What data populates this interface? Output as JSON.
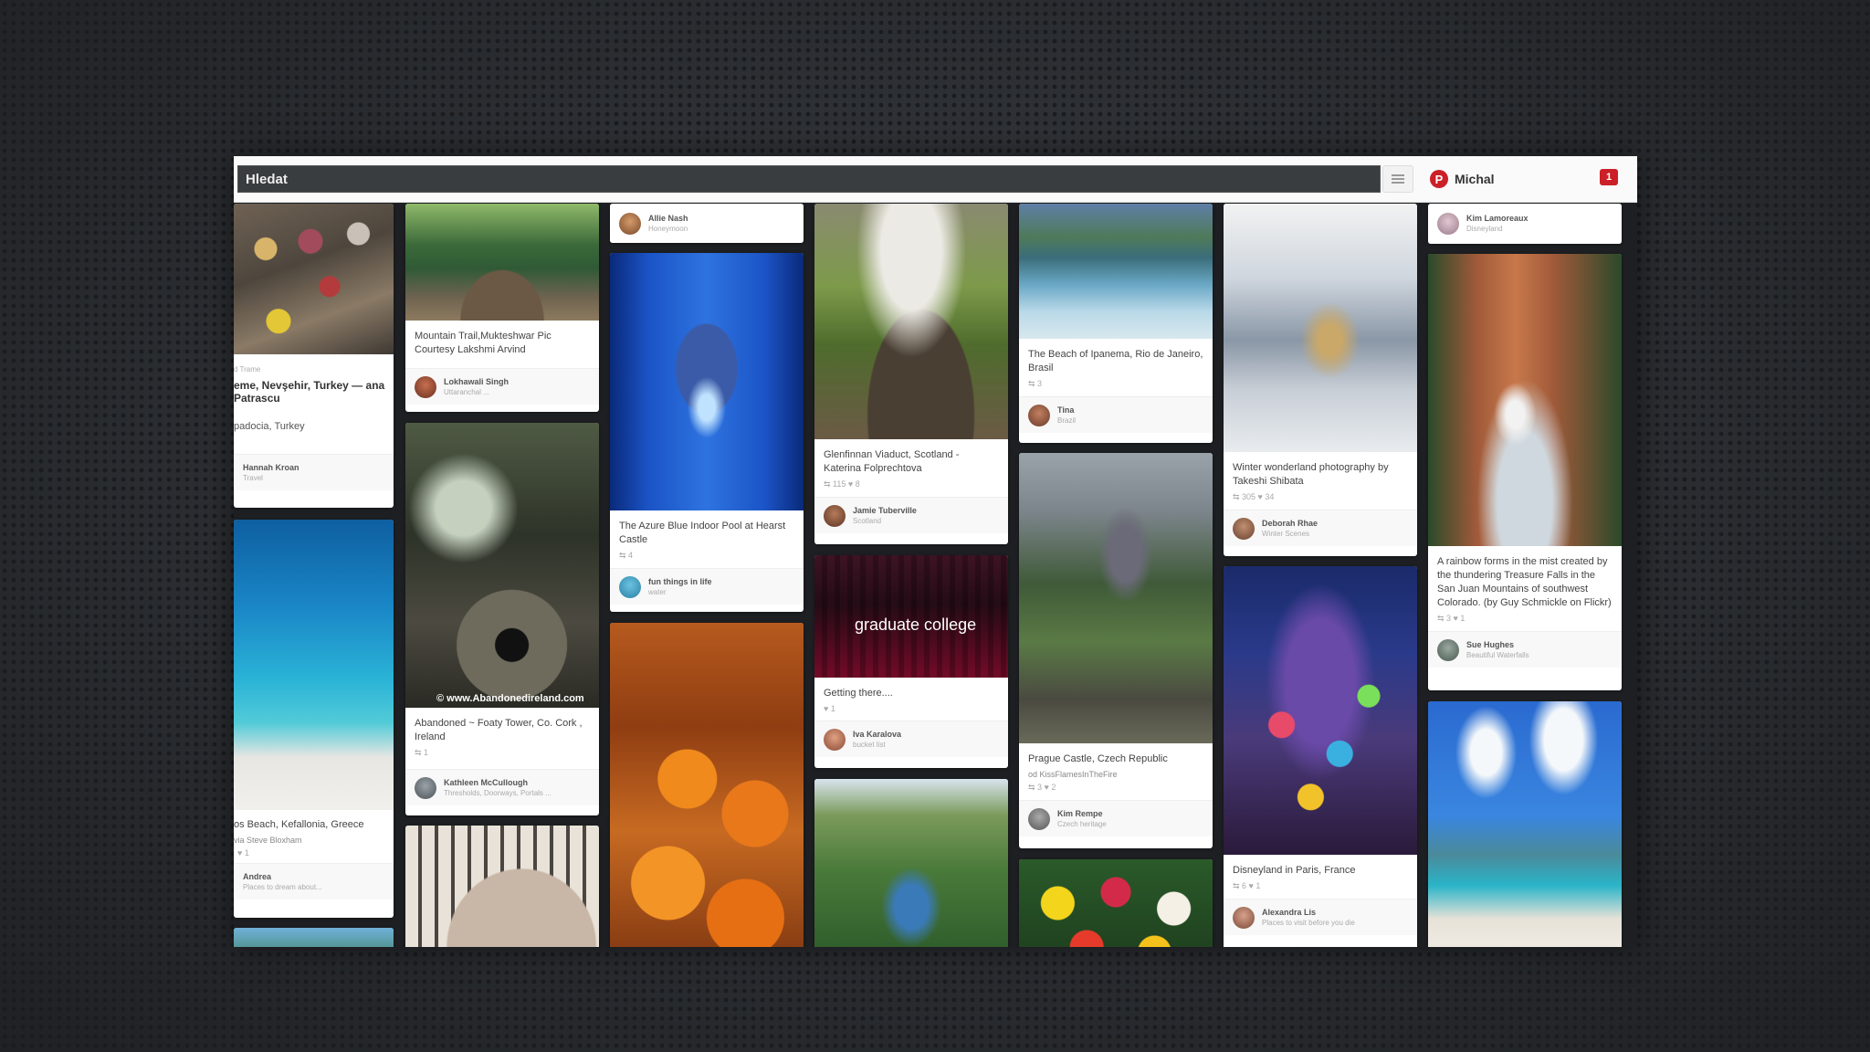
{
  "colors": {
    "brand_red": "#cb2027",
    "background": "#2a2d31"
  },
  "header": {
    "search_value": "Hledat",
    "menu_icon": "hamburger-menu-icon",
    "user_logo": "P",
    "user_name": "Michal",
    "notification_count": "1"
  },
  "pins": {
    "balloons": {
      "small_label": "d Trame",
      "title": "eme, Nevşehir, Turkey — ana Patrascu",
      "location": "padocia, Turkey",
      "pinner": "Hannah Kroan",
      "board": "Travel"
    },
    "mountain_trail": {
      "desc": "Mountain Trail,Mukteshwar Pic Courtesy Lakshmi Arvind",
      "pinner": "Lokhawali Singh",
      "board": "Uttaranchal ..."
    },
    "allie_nash": {
      "pinner": "Allie Nash",
      "board": "Honeymoon"
    },
    "glenfinnan": {
      "desc": "Glenfinnan Viaduct, Scotland - Katerina Folprechtova",
      "stats": "⇆ 115   ♥ 8",
      "pinner": "Jamie Tuberville",
      "board": "Scotland"
    },
    "ipanema": {
      "desc": "The Beach of Ipanema, Rio de Janeiro, Brasil",
      "stats": "⇆ 3",
      "pinner": "Tina",
      "board": "Brazil"
    },
    "kim_top": {
      "pinner": "Kim Lamoreaux",
      "board": "Disneyland"
    },
    "myrtos": {
      "desc": "os Beach, Kefallonia, Greece",
      "via": "via Steve Bloxham",
      "stats": "♥ 1",
      "pinner": "Andrea",
      "board": "Places to dream about..."
    },
    "abandoned": {
      "watermark": "© www.Abandonedireland.com",
      "desc": "Abandoned ~ Foaty Tower, Co. Cork , Ireland",
      "stats": "⇆ 1",
      "pinner": "Kathleen McCullough",
      "board": "Thresholds, Doorways, Portals ..."
    },
    "azure_pool": {
      "desc": "The Azure Blue Indoor Pool at Hearst Castle",
      "stats": "⇆ 4",
      "pinner": "fun things in life",
      "board": "water"
    },
    "graduate": {
      "overlay": "graduate college",
      "desc": "Getting there....",
      "stats": "♥ 1",
      "pinner": "Iva Karalova",
      "board": "bucket list"
    },
    "prague": {
      "desc": "Prague Castle, Czech Republic",
      "via": "od KissFlamesInTheFire",
      "stats": "⇆ 3   ♥ 2",
      "pinner": "Kim Rempe",
      "board": "Czech heritage"
    },
    "winter": {
      "desc": "Winter wonderland photography by Takeshi Shibata",
      "stats": "⇆ 305   ♥ 34",
      "pinner": "Deborah Rhae",
      "board": "Winter Scenes"
    },
    "disneyland": {
      "desc": "Disneyland in Paris, France",
      "stats": "⇆ 6   ♥ 1",
      "pinner": "Alexandra Lis",
      "board": "Places to visit before you die"
    },
    "treasure_falls": {
      "desc": "A rainbow forms in the mist created by the thundering Treasure Falls in the San Juan Mountains of southwest Colorado. (by Guy Schmickle on Flickr)",
      "stats": "⇆ 3   ♥ 1",
      "pinner": "Sue Hughes",
      "board": "Beautiful Waterfalls"
    }
  }
}
